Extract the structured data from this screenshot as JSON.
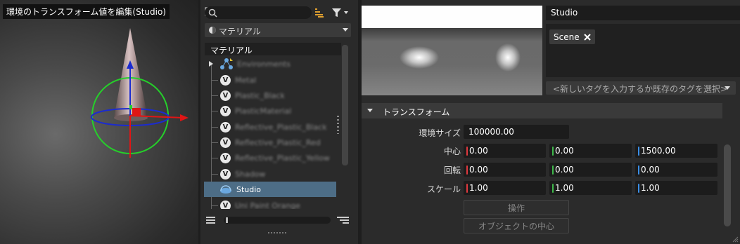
{
  "viewport": {
    "title": "環境のトランスフォーム値を編集(Studio)"
  },
  "material_panel": {
    "search_placeholder": "",
    "category": "マテリアル",
    "list_header": "マテリアル",
    "items": [
      {
        "label": "Environments",
        "icon": "environment-icon"
      },
      {
        "label": "Metal",
        "icon": "v-material-icon"
      },
      {
        "label": "Plastic_Black",
        "icon": "v-material-icon"
      },
      {
        "label": "PlasticMaterial",
        "icon": "v-material-icon"
      },
      {
        "label": "Reflective_Plastic_Black",
        "icon": "v-material-icon"
      },
      {
        "label": "Reflective_Plastic_Red",
        "icon": "v-material-icon"
      },
      {
        "label": "Reflective_Plastic_Yellow",
        "icon": "v-material-icon"
      },
      {
        "label": "Shadow",
        "icon": "v-material-icon"
      },
      {
        "label": "Studio",
        "icon": "environment-dome-icon",
        "selected": true
      },
      {
        "label": "Uni Paint Orange",
        "icon": "v-material-icon"
      }
    ],
    "v_glyph": "V"
  },
  "properties": {
    "name": "Studio",
    "tags": [
      "Scene"
    ],
    "tag_placeholder": "<新しいタグを入力するか既存のタグを選択>",
    "section_title": "トランスフォーム",
    "size_label": "環境サイズ",
    "size_value": "100000.00",
    "center_label": "中心",
    "center": [
      "0.00",
      "0.00",
      "1500.00"
    ],
    "rotate_label": "回転",
    "rotate": [
      "0.00",
      "0.00",
      "0.00"
    ],
    "scale_label": "スケール",
    "scale": [
      "1.00",
      "1.00",
      "1.00"
    ],
    "manipulate_button": "操作",
    "center_object_button": "オブジェクトの中心",
    "axis_colors": {
      "x": "#e0393e",
      "y": "#3fb94a",
      "z": "#3a8ee6"
    }
  }
}
